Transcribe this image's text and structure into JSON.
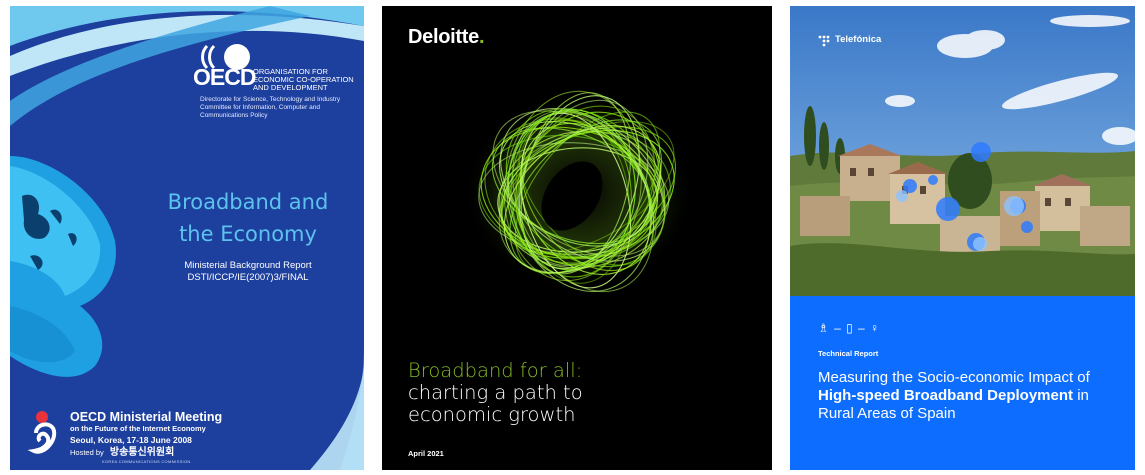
{
  "oecd": {
    "logo_text": "OECD",
    "org_name": "ORGANISATION FOR ECONOMIC CO-OPERATION AND DEVELOPMENT",
    "directorate": "Directorate for Science, Technology and Industry Committee for Information, Computer and Communications Policy",
    "title_line1": "Broadband and",
    "title_line2": "the Economy",
    "subtitle_line1": "Ministerial Background Report",
    "subtitle_line2": "DSTI/ICCP/IE(2007)3/FINAL",
    "meeting_title": "OECD Ministerial Meeting",
    "meeting_sub": "on the Future of the Internet Economy",
    "meeting_date": "Seoul, Korea, 17-18 June 2008",
    "hosted_by": "Hosted by",
    "host_name": "방송통신위원회",
    "host_name_en": "KOREA COMMUNICATIONS COMMISSION",
    "colors": {
      "background": "#1d3f9e",
      "title": "#5cc3ee",
      "swoosh": "#3fa6e0"
    }
  },
  "deloitte": {
    "brand": "Deloitte",
    "brand_dot": ".",
    "title_line1": "Broadband for all:",
    "title_line2": "charting a path to",
    "title_line3": "economic growth",
    "date": "April 2021",
    "colors": {
      "background": "#000000",
      "accent": "#86bc25"
    }
  },
  "telefonica": {
    "brand": "Telefónica",
    "glyphs": "♗ – ▯ – ♀",
    "tag": "Technical Report",
    "title_part1": "Measuring the Socio-economic Impact of ",
    "title_bold1": "High-speed Broadband Deployment",
    "title_part2": " in Rural Areas of Spain",
    "colors": {
      "background": "#0d6dff",
      "sky": "#4f8fd6"
    }
  }
}
